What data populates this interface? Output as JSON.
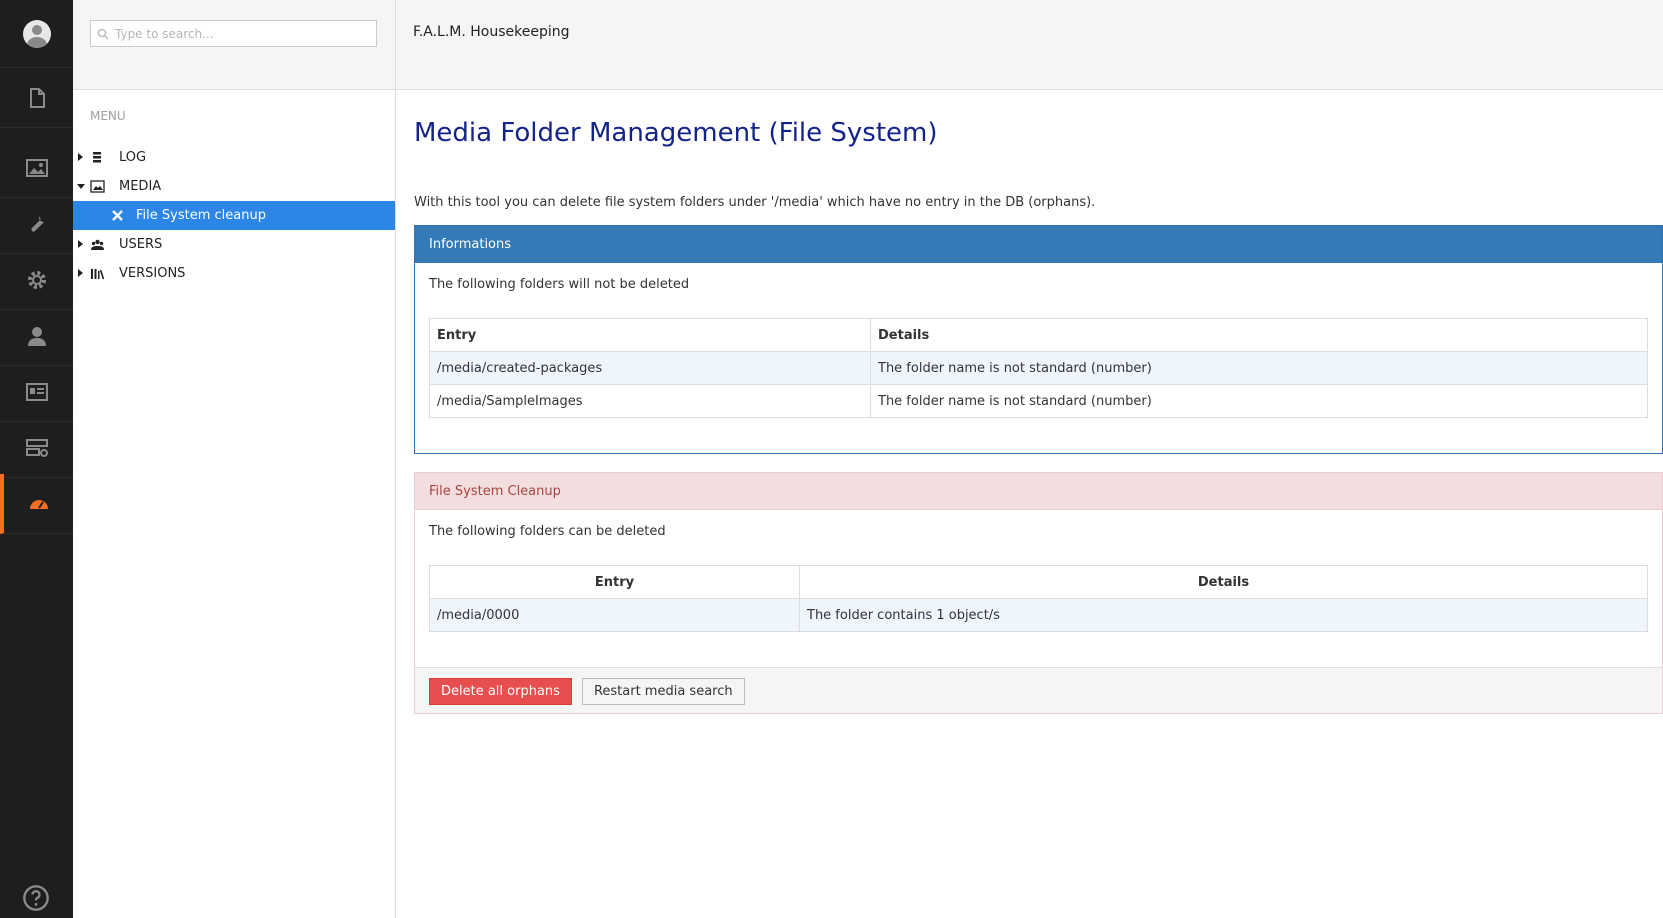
{
  "search": {
    "placeholder": "Type to search..."
  },
  "module": {
    "title": "F.A.L.M. Housekeeping"
  },
  "menu": {
    "label": "MENU",
    "items": [
      {
        "label": "LOG",
        "icon": "list-icon",
        "expanded": false
      },
      {
        "label": "MEDIA",
        "icon": "image-icon",
        "expanded": true
      },
      {
        "label": "File System cleanup",
        "icon": "x-icon",
        "selected": true
      },
      {
        "label": "USERS",
        "icon": "users-icon",
        "expanded": false
      },
      {
        "label": "VERSIONS",
        "icon": "books-icon",
        "expanded": false
      }
    ]
  },
  "page": {
    "title": "Media Folder Management (File System)",
    "intro": "With this tool you can delete file system folders under '/media' which have no entry in the DB (orphans)."
  },
  "info_panel": {
    "heading": "Informations",
    "description": "The following folders will not be deleted",
    "columns": [
      "Entry",
      "Details"
    ],
    "rows": [
      [
        "/media/created-packages",
        "The folder name is not standard (number)"
      ],
      [
        "/media/SampleImages",
        "The folder name is not standard (number)"
      ]
    ]
  },
  "cleanup_panel": {
    "heading": "File System Cleanup",
    "description": "The following folders can be deleted",
    "columns": [
      "Entry",
      "Details"
    ],
    "rows": [
      [
        "/media/0000",
        "The folder contains 1 object/s"
      ]
    ],
    "delete_button": "Delete all orphans",
    "restart_button": "Restart media search"
  },
  "colors": {
    "accent": "#f36f21",
    "selected": "#2c86e5",
    "title": "#13238a",
    "info_header": "#337ab7",
    "danger_header_bg": "#f2dede",
    "danger_button": "#e74e4e"
  }
}
